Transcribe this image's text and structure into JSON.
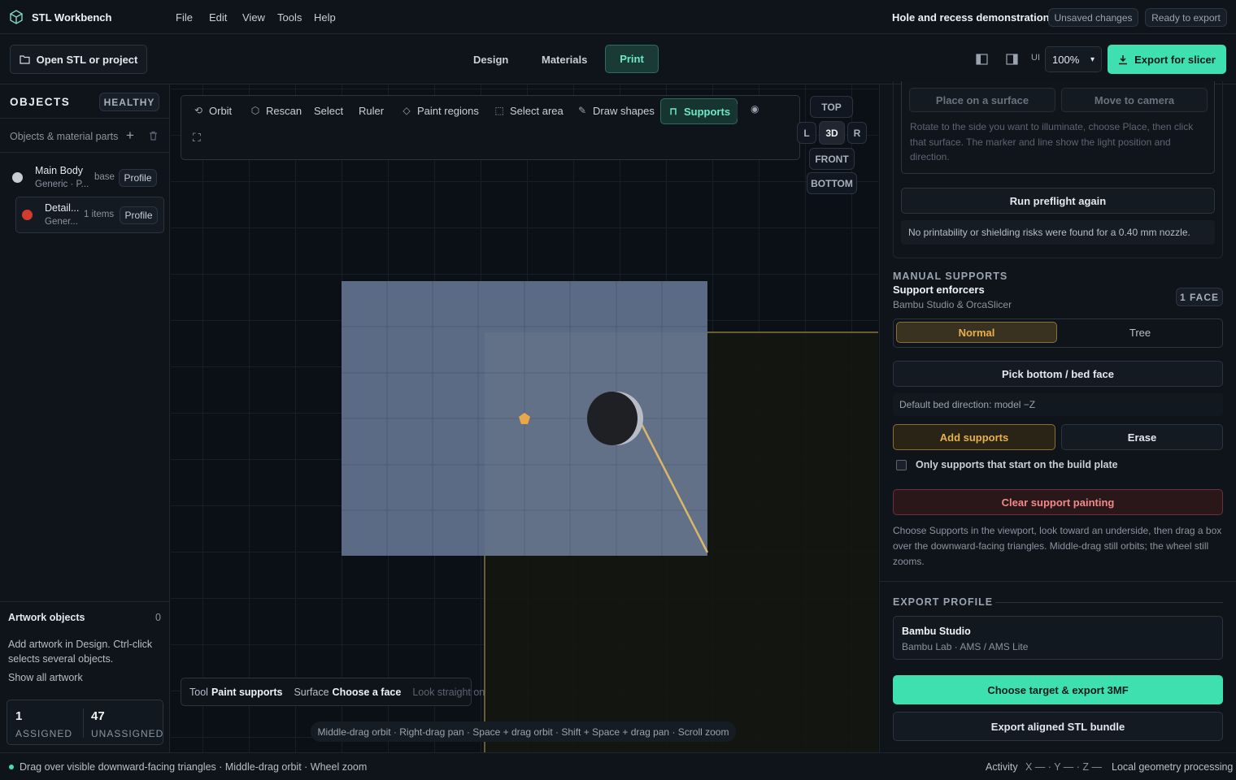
{
  "app": {
    "name": "STL Workbench",
    "file": "Hole and recess demonstration.stl",
    "badge_unsaved": "Unsaved changes",
    "badge_ready": "Ready to export"
  },
  "menu": [
    "File",
    "Edit",
    "View",
    "Tools",
    "Help"
  ],
  "toolbar": {
    "open_label": "Open STL or project",
    "tabs": [
      "Design",
      "Materials",
      "Print"
    ],
    "active_tab": "Print",
    "ui_label": "UI",
    "zoom": "100%",
    "export_label": "Export for slicer"
  },
  "objects": {
    "title": "OBJECTS",
    "health": "HEALTHY",
    "subtitle": "Objects & material parts",
    "items": [
      {
        "name": "Main Body",
        "sub": "Generic · P...",
        "tag": "base",
        "profile": "Profile",
        "color": "#c9ccd1"
      },
      {
        "name": "Detail...",
        "sub": "Gener...",
        "tag": "1 items",
        "profile": "Profile",
        "color": "#d33b2f"
      }
    ]
  },
  "artwork": {
    "title": "Artwork objects",
    "count": "0",
    "desc": "Add artwork in Design. Ctrl-click selects several objects.",
    "link": "Show all artwork",
    "assigned_n": "1",
    "assigned_label": "ASSIGNED",
    "unassigned_n": "47",
    "unassigned_label": "UNASSIGNED"
  },
  "viewport": {
    "tools": [
      "Orbit",
      "Rescan",
      "Select",
      "Ruler",
      "Paint regions",
      "Select area",
      "Draw shapes",
      "Supports"
    ],
    "active_tool": "Supports",
    "views": {
      "top": "TOP",
      "left": "L",
      "three_d": "3D",
      "right": "R",
      "front": "FRONT",
      "bottom": "BOTTOM"
    },
    "tool_status": {
      "tool_label": "Tool",
      "tool_value": "Paint supports",
      "surface_label": "Surface",
      "surface_value": "Choose a face",
      "hint": "Look straight on"
    },
    "controls_hint": "Middle-drag orbit · Right-drag pan · Space + drag orbit · Shift + Space + drag pan · Scroll zoom"
  },
  "right": {
    "place_label": "Place on a surface",
    "camera_label": "Move to camera",
    "rotate_help": "Rotate to the side you want to illuminate, choose Place, then click that surface. The marker and line show the light position and direction.",
    "preflight_label": "Run preflight again",
    "preflight_result": "No printability or shielding risks were found for a 0.40 mm nozzle.",
    "manual_title": "MANUAL SUPPORTS",
    "enforcers_title": "Support enforcers",
    "enforcers_sub": "Bambu Studio & OrcaSlicer",
    "face_count": "1 FACE",
    "mode_normal": "Normal",
    "mode_tree": "Tree",
    "mode_active": "Normal",
    "pick_bottom": "Pick bottom / bed face",
    "bed_direction": "Default bed direction: model −Z",
    "add_supports": "Add supports",
    "erase": "Erase",
    "only_plate": "Only supports that start on the build plate",
    "clear_painting": "Clear support painting",
    "help": "Choose Supports in the viewport, look toward an underside, then drag a box over the downward-facing triangles. Middle-drag still orbits; the wheel still zooms.",
    "export_profile_title": "EXPORT PROFILE",
    "profile_name": "Bambu Studio",
    "profile_sub": "Bambu Lab · AMS / AMS Lite",
    "export_3mf": "Choose target & export 3MF",
    "export_stl": "Export aligned STL bundle"
  },
  "status": {
    "message": "Drag over visible downward-facing triangles · Middle-drag orbit · Wheel zoom",
    "activity": "Activity",
    "coords": "X — · Y — · Z —",
    "processing": "Local geometry processing"
  },
  "colors": {
    "accent": "#3ee0b0",
    "warn": "#e8b04a",
    "danger": "#e06060",
    "model": "#5c6b85"
  }
}
